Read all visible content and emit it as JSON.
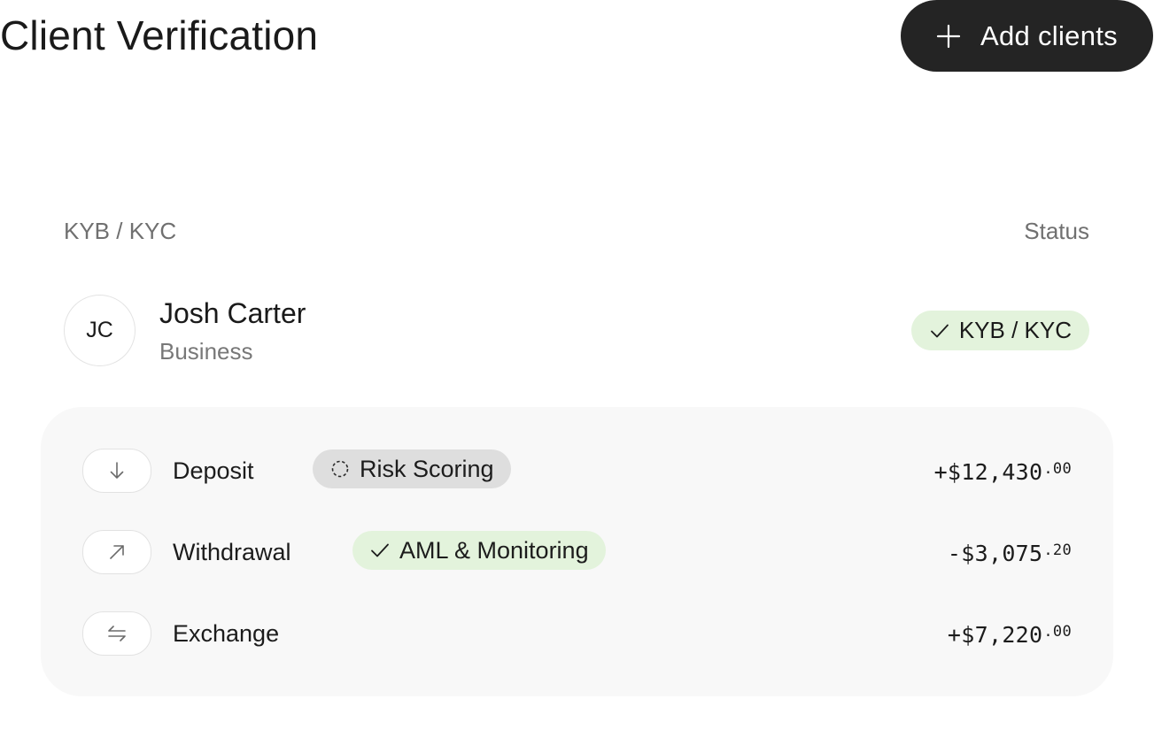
{
  "header": {
    "title": "Client Verification",
    "add_button_label": "Add clients"
  },
  "table": {
    "left_header": "KYB / KYC",
    "right_header": "Status"
  },
  "client": {
    "initials": "JC",
    "name": "Josh Carter",
    "type": "Business",
    "status_label": "KYB / KYC",
    "status_color": "#e3f3dc"
  },
  "transactions": [
    {
      "label": "Deposit",
      "icon": "arrow-down-icon",
      "tag": "Risk Scoring",
      "tag_state": "pending",
      "amount_main": "+$12,430",
      "amount_cents": ".00"
    },
    {
      "label": "Withdrawal",
      "icon": "arrow-up-right-icon",
      "tag": "AML & Monitoring",
      "tag_state": "verified",
      "amount_main": "-$3,075",
      "amount_cents": ".20"
    },
    {
      "label": "Exchange",
      "icon": "exchange-arrows-icon",
      "tag": "",
      "amount_main": "+$7,220",
      "amount_cents": ".00"
    }
  ],
  "colors": {
    "primary_button": "#242424",
    "success_badge": "#e3f3dc",
    "pending_badge": "#dedede",
    "panel_background": "#f8f8f8"
  }
}
